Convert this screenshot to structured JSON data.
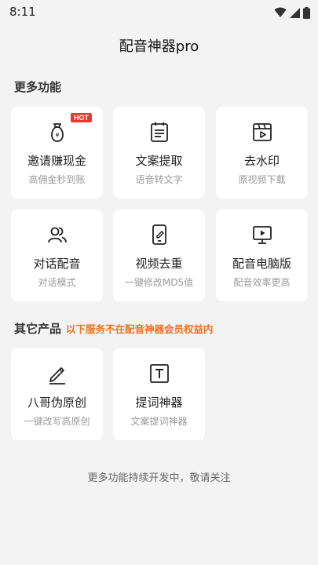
{
  "status_bar": {
    "time": "8:11"
  },
  "header": {
    "title": "配音神器pro"
  },
  "sections": {
    "more": {
      "title": "更多功能"
    },
    "other": {
      "title": "其它产品",
      "subtitle": "以下服务不在配音神器会员权益内"
    }
  },
  "cards": [
    {
      "label": "邀请赚现金",
      "desc": "高佣金秒到账",
      "icon": "money-bag-icon",
      "badge": "HOT"
    },
    {
      "label": "文案提取",
      "desc": "语音转文字",
      "icon": "notepad-icon"
    },
    {
      "label": "去水印",
      "desc": "原视频下载",
      "icon": "video-clapper-icon"
    },
    {
      "label": "对话配音",
      "desc": "对话模式",
      "icon": "two-users-icon"
    },
    {
      "label": "视频去重",
      "desc": "一键修改MD5值",
      "icon": "phone-edit-icon"
    },
    {
      "label": "配音电脑版",
      "desc": "配音效率更高",
      "icon": "monitor-play-icon"
    },
    {
      "label": "八哥伪原创",
      "desc": "一键改写高原创",
      "icon": "pen-icon"
    },
    {
      "label": "提词神器",
      "desc": "文案提词神器",
      "icon": "text-box-icon"
    }
  ],
  "footer": {
    "note": "更多功能持续开发中，敬请关注"
  }
}
